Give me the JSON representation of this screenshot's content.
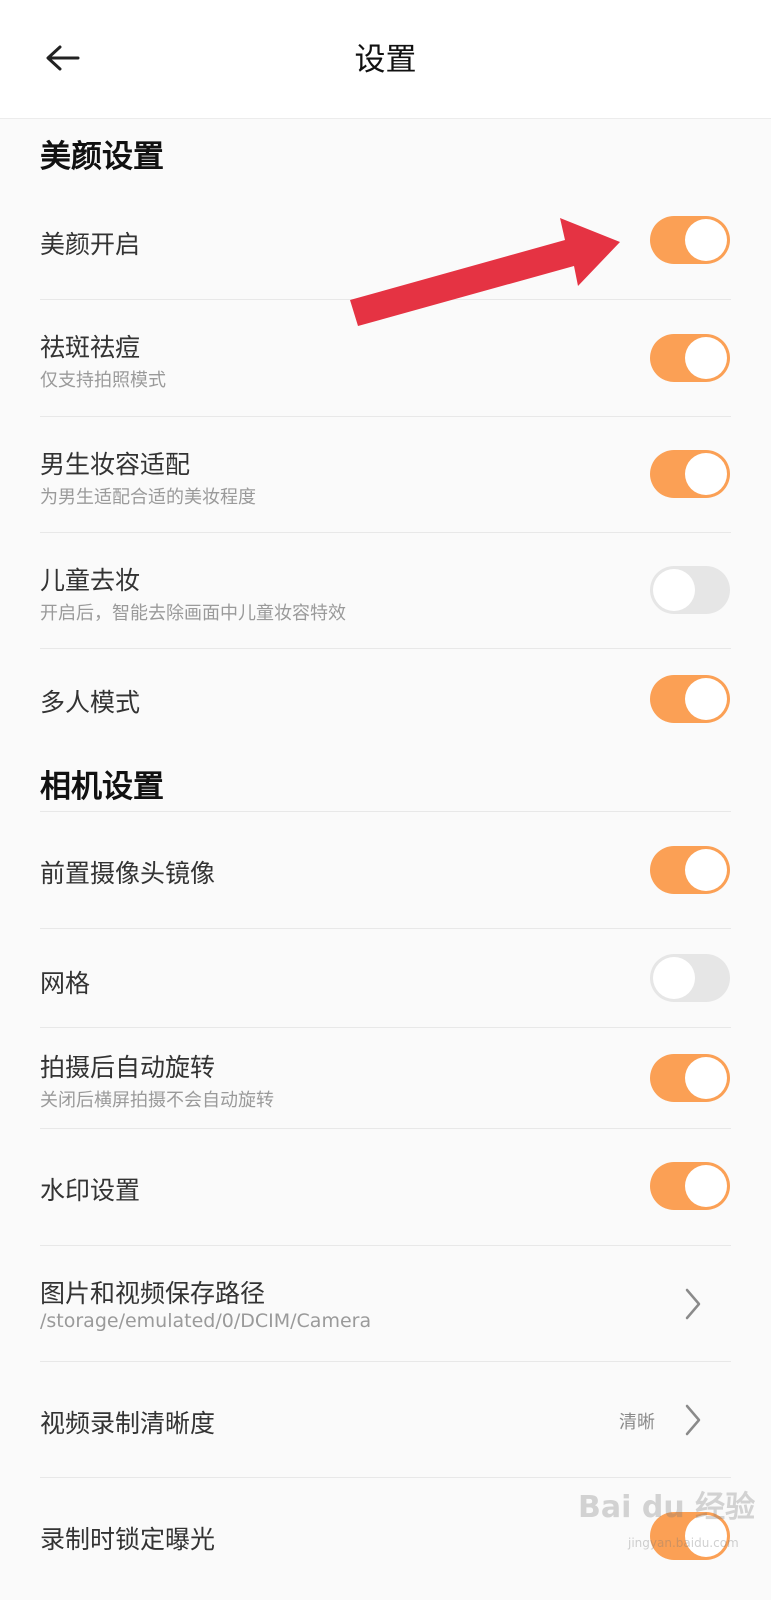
{
  "header": {
    "title": "设置"
  },
  "beauty": {
    "section_title": "美颜设置",
    "items": [
      {
        "label": "美颜开启",
        "sub": "",
        "on": true
      },
      {
        "label": "祛斑祛痘",
        "sub": "仅支持拍照模式",
        "on": true
      },
      {
        "label": "男生妆容适配",
        "sub": "为男生适配合适的美妆程度",
        "on": true
      },
      {
        "label": "儿童去妆",
        "sub": "开启后，智能去除画面中儿童妆容特效",
        "on": false
      },
      {
        "label": "多人模式",
        "sub": "",
        "on": true
      }
    ]
  },
  "camera": {
    "section_title": "相机设置",
    "items": [
      {
        "label": "前置摄像头镜像",
        "on": true
      },
      {
        "label": "网格",
        "on": false
      },
      {
        "label": "拍摄后自动旋转",
        "sub": "关闭后横屏拍摄不会自动旋转",
        "on": true
      },
      {
        "label": "水印设置",
        "on": true
      },
      {
        "label": "图片和视频保存路径",
        "sub": "/storage/emulated/0/DCIM/Camera"
      },
      {
        "label": "视频录制清晰度",
        "value": "清晰"
      },
      {
        "label": "录制时锁定曝光",
        "on": true
      }
    ]
  },
  "watermark": {
    "text": "Bai du 经验",
    "sub": "jingyan.baidu.com"
  },
  "colors": {
    "accent": "#fba055",
    "toggle_off": "#e6e6e6",
    "annotation_arrow": "#e53343"
  }
}
